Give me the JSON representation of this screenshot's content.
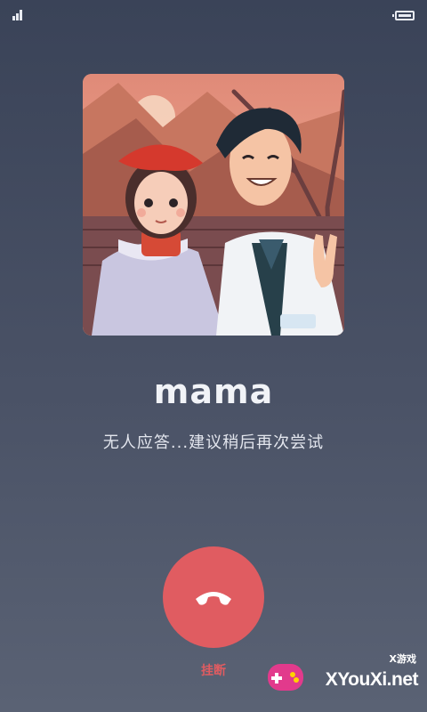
{
  "status_bar": {
    "signal_icon": "signal-bars-icon",
    "battery_icon": "battery-full-icon"
  },
  "contact": {
    "name": "mama",
    "avatar": "illustrated-couple-portrait"
  },
  "call": {
    "status_text": "无人应答...建议稍后再次尝试"
  },
  "hangup": {
    "icon": "phone-hangup-icon",
    "label": "挂断",
    "color": "#e05c61"
  },
  "watermark": {
    "sub": "X游戏",
    "main": "XYouXi.net"
  }
}
